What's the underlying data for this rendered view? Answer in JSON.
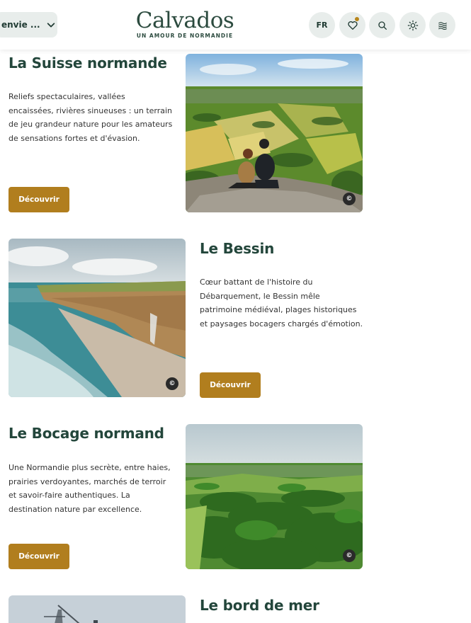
{
  "header": {
    "envie_label": "envie ...",
    "logo_name": "Calvados",
    "logo_tagline": "UN AMOUR DE NORMANDIE",
    "lang_label": "FR"
  },
  "sections": [
    {
      "title": "La Suisse normande",
      "description": "Reliefs spectaculaires, vallées encaissées, rivières sinueuses : un terrain de jeu grandeur nature pour les amateurs de sensations fortes et d'évasion.",
      "button": "Découvrir",
      "credit": "©"
    },
    {
      "title": "Le Bessin",
      "description": "Cœur battant de l'histoire du Débarquement, le Bessin mêle patrimoine médiéval, plages historiques et paysages bocagers chargés d'émotion.",
      "button": "Découvrir",
      "credit": "©"
    },
    {
      "title": "Le Bocage normand",
      "description": "Une Normandie plus secrète, entre haies, prairies verdoyantes, marchés de terroir et savoir-faire authentiques. La destination nature par excellence.",
      "button": "Découvrir",
      "credit": "©"
    },
    {
      "title": "Le bord de mer"
    }
  ],
  "colors": {
    "brand_green": "#23463b",
    "button_gold": "#b17e1e",
    "header_button_bg": "#e8edeb"
  }
}
